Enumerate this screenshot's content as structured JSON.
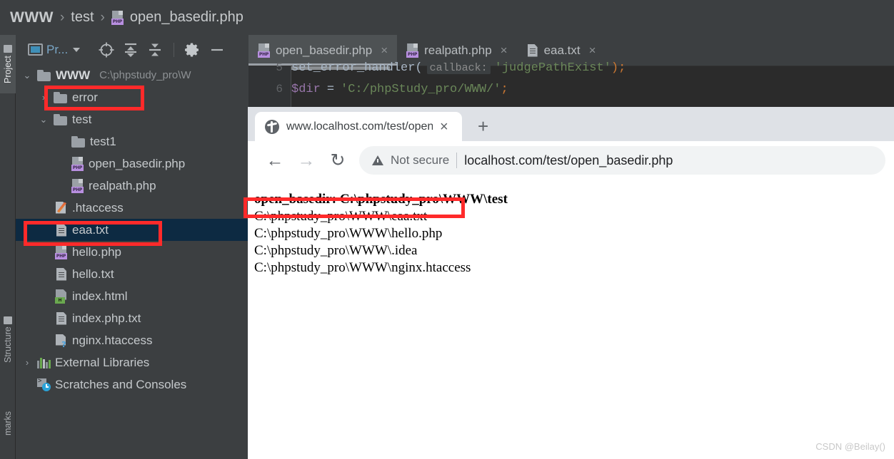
{
  "breadcrumb": {
    "items": [
      "WWW",
      "test",
      "open_basedir.php"
    ],
    "separator": "›",
    "file_icon": "php-file-icon"
  },
  "tool_strip": {
    "tabs": [
      {
        "label": "Project",
        "active": true
      },
      {
        "label": "Structure",
        "active": false
      },
      {
        "label": "marks",
        "active": false
      }
    ]
  },
  "project_panel": {
    "title": "Pr...",
    "toolbar_icons": [
      "locate-icon",
      "expand-all-icon",
      "collapse-all-icon",
      "gear-icon",
      "minimize-icon"
    ],
    "tree": [
      {
        "arrow": "⌄",
        "icon": "folder-icon",
        "label": "WWW",
        "bold": true,
        "sub": "C:\\phpstudy_pro\\W",
        "indent": 0
      },
      {
        "arrow": "›",
        "icon": "folder-icon",
        "label": "error",
        "indent": 1
      },
      {
        "arrow": "⌄",
        "icon": "folder-icon",
        "label": "test",
        "indent": 1
      },
      {
        "arrow": "",
        "icon": "folder-icon",
        "label": "test1",
        "indent": 2
      },
      {
        "arrow": "",
        "icon": "php-file-icon",
        "label": "open_basedir.php",
        "indent": 2
      },
      {
        "arrow": "",
        "icon": "php-file-icon",
        "label": "realpath.php",
        "indent": 2
      },
      {
        "arrow": "",
        "icon": "feather-icon",
        "label": ".htaccess",
        "indent": 1
      },
      {
        "arrow": "",
        "icon": "txt-file-icon",
        "label": "eaa.txt",
        "indent": 1,
        "selected": true
      },
      {
        "arrow": "",
        "icon": "php-file-icon",
        "label": "hello.php",
        "indent": 1
      },
      {
        "arrow": "",
        "icon": "txt-file-icon",
        "label": "hello.txt",
        "indent": 1
      },
      {
        "arrow": "",
        "icon": "html-file-icon",
        "label": "index.html",
        "indent": 1
      },
      {
        "arrow": "",
        "icon": "txt-file-icon",
        "label": "index.php.txt",
        "indent": 1
      },
      {
        "arrow": "",
        "icon": "unknown-file-icon",
        "label": "nginx.htaccess",
        "indent": 1
      },
      {
        "arrow": "›",
        "icon": "libraries-icon",
        "label": "External Libraries",
        "indent": 0
      },
      {
        "arrow": "",
        "icon": "scratches-icon",
        "label": "Scratches and Consoles",
        "indent": 0
      }
    ]
  },
  "editor": {
    "tabs": [
      {
        "label": "open_basedir.php",
        "icon": "php-file-icon",
        "close": "×",
        "active": true
      },
      {
        "label": "realpath.php",
        "icon": "php-file-icon",
        "close": "×",
        "active": false
      },
      {
        "label": "eaa.txt",
        "icon": "txt-file-icon",
        "close": "×",
        "active": false
      }
    ],
    "lines": [
      {
        "number": "5",
        "fn": "set_error_handler(",
        "hint": "callback:",
        "param": "'judgePathExist'",
        "tail": ");"
      },
      {
        "number": "6",
        "var": "$dir",
        "op": "=",
        "str": "'C:/phpStudy_pro/WWW/'",
        "semi": ";"
      }
    ]
  },
  "browser": {
    "tab": {
      "title": "www.localhost.com/test/open_",
      "close_label": "×",
      "favicon": "globe-icon"
    },
    "new_tab_label": "+",
    "nav": {
      "back": "←",
      "forward": "→",
      "reload": "↻"
    },
    "omnibox": {
      "security_label": "Not secure",
      "url": "localhost.com/test/open_basedir.php"
    },
    "page": {
      "heading": "open_basedir: C:\\phpstudy_pro\\WWW\\test",
      "lines": [
        "C:\\phpstudy_pro\\WWW\\eaa.txt",
        "C:\\phpstudy_pro\\WWW\\hello.php",
        "C:\\phpstudy_pro\\WWW\\.idea",
        "C:\\phpstudy_pro\\WWW\\nginx.htaccess"
      ]
    }
  },
  "watermark": "CSDN @Beilay()",
  "colors": {
    "annotation": "#ff2a2a",
    "ide_bg": "#3c3f41",
    "editor_bg": "#2b2b2b",
    "selection": "#0d2a42"
  }
}
